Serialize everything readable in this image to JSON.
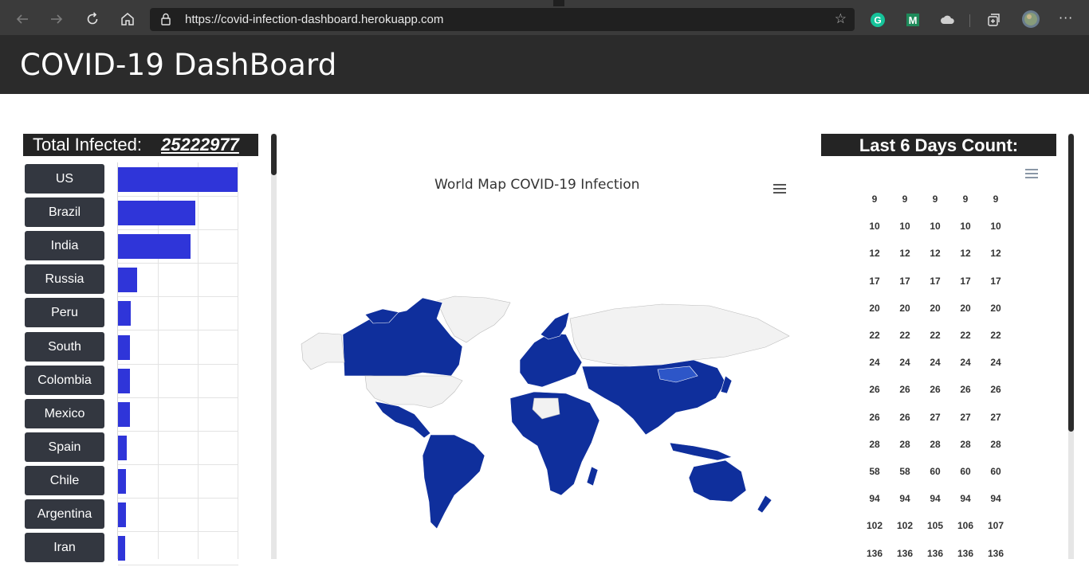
{
  "browser": {
    "url": "https://covid-infection-dashboard.herokuapp.com",
    "back_icon": "arrow-left-icon",
    "forward_icon": "arrow-right-icon",
    "refresh_icon": "refresh-icon",
    "home_icon": "home-icon",
    "more_label": "···"
  },
  "page": {
    "title": "COVID-19 DashBoard"
  },
  "total": {
    "label": "Total Infected:",
    "value": "25222977"
  },
  "countries": [
    {
      "name": "US",
      "bar": 1.0
    },
    {
      "name": "Brazil",
      "bar": 0.645
    },
    {
      "name": "India",
      "bar": 0.605
    },
    {
      "name": "Russia",
      "bar": 0.162
    },
    {
      "name": "Peru",
      "bar": 0.105
    },
    {
      "name": "South",
      "bar": 0.102
    },
    {
      "name": "Colombia",
      "bar": 0.098
    },
    {
      "name": "Mexico",
      "bar": 0.097
    },
    {
      "name": "Spain",
      "bar": 0.073
    },
    {
      "name": "Chile",
      "bar": 0.067
    },
    {
      "name": "Argentina",
      "bar": 0.067
    },
    {
      "name": "Iran",
      "bar": 0.062
    }
  ],
  "map": {
    "title": "World Map COVID-19 Infection",
    "fill_color": "#0f2f9c",
    "empty_color": "#f2f2f2"
  },
  "last_days": {
    "label": "Last 6 Days Count:",
    "rows": [
      [
        "9",
        "9",
        "9",
        "9",
        "9"
      ],
      [
        "10",
        "10",
        "10",
        "10",
        "10"
      ],
      [
        "12",
        "12",
        "12",
        "12",
        "12"
      ],
      [
        "17",
        "17",
        "17",
        "17",
        "17"
      ],
      [
        "20",
        "20",
        "20",
        "20",
        "20"
      ],
      [
        "22",
        "22",
        "22",
        "22",
        "22"
      ],
      [
        "24",
        "24",
        "24",
        "24",
        "24"
      ],
      [
        "26",
        "26",
        "26",
        "26",
        "26"
      ],
      [
        "26",
        "26",
        "27",
        "27",
        "27"
      ],
      [
        "28",
        "28",
        "28",
        "28",
        "28"
      ],
      [
        "58",
        "58",
        "60",
        "60",
        "60"
      ],
      [
        "94",
        "94",
        "94",
        "94",
        "94"
      ],
      [
        "102",
        "102",
        "105",
        "106",
        "107"
      ],
      [
        "136",
        "136",
        "136",
        "136",
        "136"
      ]
    ]
  },
  "colors": {
    "bar": "#2f35d9",
    "header": "#2b2b2b",
    "button": "#333740"
  }
}
